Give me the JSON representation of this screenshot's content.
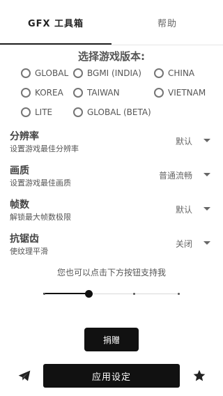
{
  "tabs": [
    {
      "label": "GFX 工具箱",
      "active": true
    },
    {
      "label": "帮助",
      "active": false
    }
  ],
  "version_section": {
    "title": "选择游戏版本:",
    "options": [
      "GLOBAL",
      "BGMI (INDIA)",
      "CHINA",
      "KOREA",
      "TAIWAN",
      "VIETNAM",
      "LITE",
      "GLOBAL (BETA)"
    ]
  },
  "settings": [
    {
      "label": "分辨率",
      "description": "设置游戏最佳分辨率",
      "value": "默认"
    },
    {
      "label": "画质",
      "description": "设置游戏最佳画质",
      "value": "普通流畅"
    },
    {
      "label": "帧数",
      "description": "解锁最大帧数极限",
      "value": "默认"
    },
    {
      "label": "抗锯齿",
      "description": "使纹理平滑",
      "value": "关闭"
    }
  ],
  "support": {
    "text": "您也可以点击下方按钮支持我",
    "slider_level": 0.33
  },
  "buttons": {
    "donate": "捐赠",
    "apply": "应用设定"
  },
  "icons": {
    "telegram": "telegram-icon",
    "star": "star-icon"
  },
  "colors": {
    "primary": "#111111",
    "background": "#ffffff"
  }
}
